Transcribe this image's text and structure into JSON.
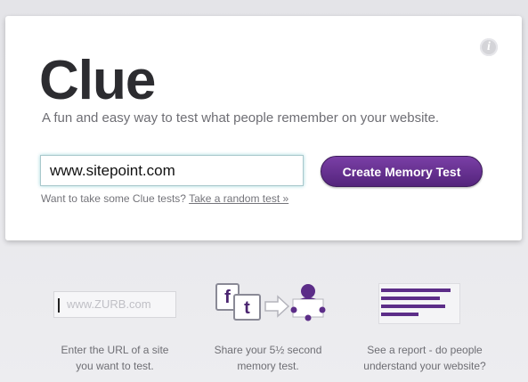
{
  "app": {
    "logo": "Clue",
    "tagline": "A fun and easy way to test what people remember on your website."
  },
  "form": {
    "url_value": "www.sitepoint.com",
    "button_label": "Create Memory Test",
    "hint_text": "Want to take some Clue tests?",
    "hint_link": "Take a random test »"
  },
  "steps": [
    {
      "example_placeholder": "www.ZURB.com",
      "caption_line1": "Enter the URL of a site",
      "caption_line2": "you want to test."
    },
    {
      "fb_glyph": "f",
      "tw_glyph": "t",
      "caption_line1": "Share your 5½ second",
      "caption_line2": "memory test."
    },
    {
      "caption_line1": "See a report - do people",
      "caption_line2": "understand your website?"
    }
  ],
  "icons": {
    "info": "info-icon",
    "facebook": "facebook-icon",
    "twitter": "twitter-icon",
    "arrow": "arrow-right-icon",
    "person": "person-icon",
    "report": "report-icon"
  },
  "colors": {
    "brand_purple": "#5c2d88",
    "input_glow": "#9fd6dc",
    "logo_text": "#2c2c30"
  }
}
